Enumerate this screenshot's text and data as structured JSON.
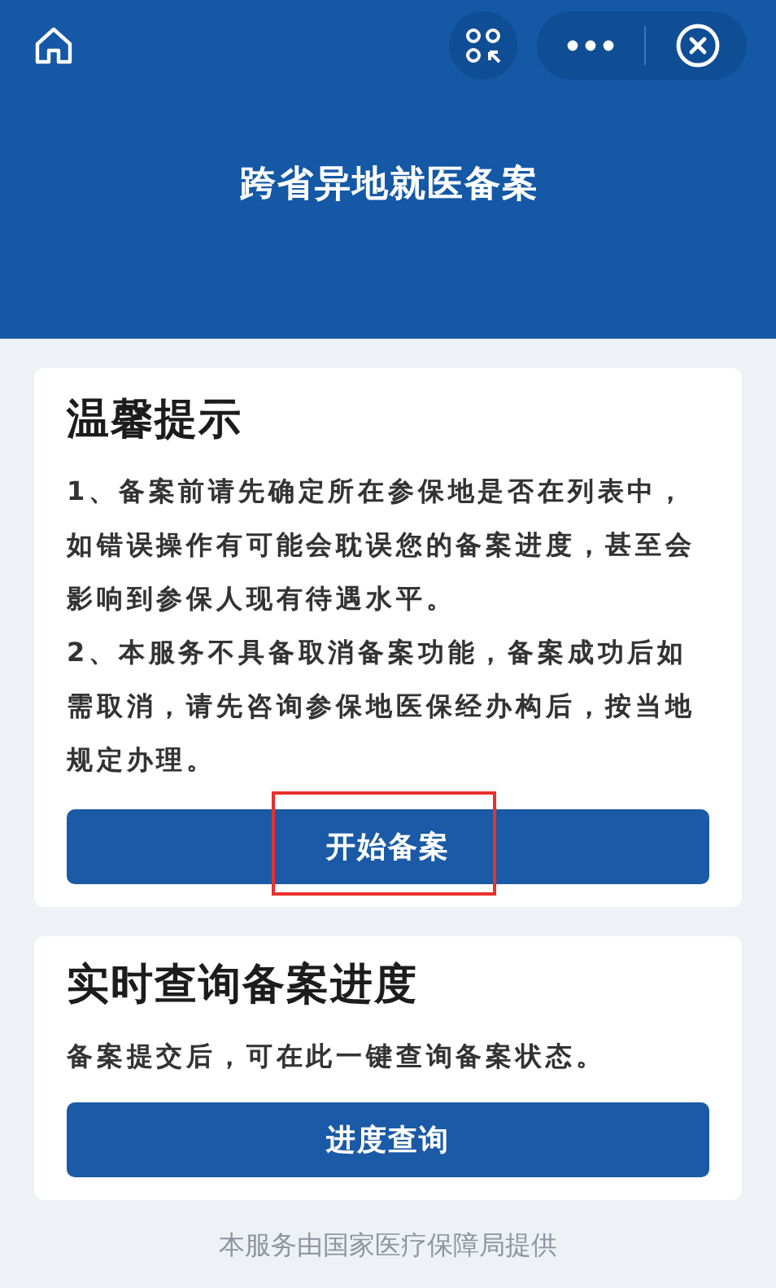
{
  "header": {
    "title": "跨省异地就医备案"
  },
  "tips_card": {
    "title": "温馨提示",
    "paragraphs": [
      "1、备案前请先确定所在参保地是否在列表中，如错误操作有可能会耽误您的备案进度，甚至会影响到参保人现有待遇水平。",
      "2、本服务不具备取消备案功能，备案成功后如需取消，请先咨询参保地医保经办构后，按当地规定办理。"
    ],
    "button": {
      "label": "开始备案",
      "highlighted": true
    }
  },
  "query_card": {
    "title": "实时查询备案进度",
    "text": "备案提交后，可在此一键查询备案状态。",
    "button": {
      "label": "进度查询"
    }
  },
  "footer": "本服务由国家医疗保障局提供"
}
